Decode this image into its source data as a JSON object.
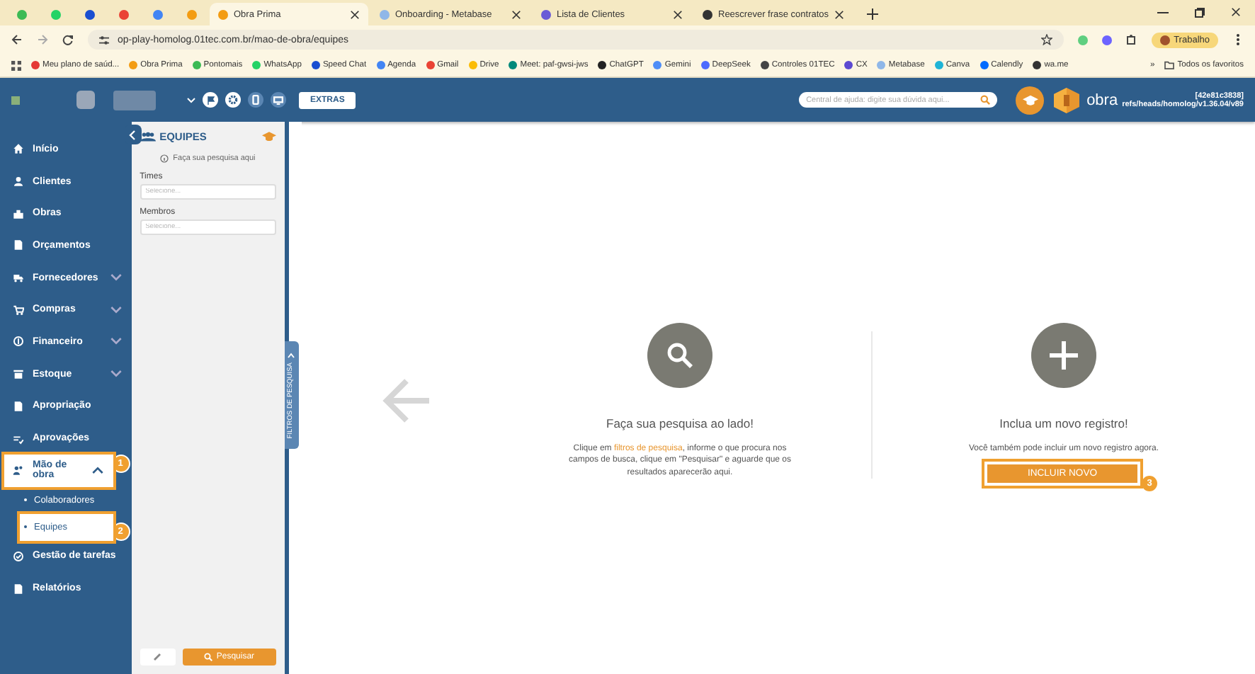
{
  "browser": {
    "pinned_tabs": [
      {
        "color": "#3cba54",
        "selected": false
      },
      {
        "color": "#25d366",
        "selected": false
      },
      {
        "color": "#1a4fd1",
        "selected": false
      },
      {
        "color": "#ea4335",
        "selected": false
      },
      {
        "color": "#4285f4",
        "selected": false
      },
      {
        "color": "#f39c12",
        "selected": false
      }
    ],
    "tabs": [
      {
        "title": "Obra Prima",
        "color": "#f39c12",
        "selected": true
      },
      {
        "title": "Onboarding - Metabase",
        "color": "#8fb7e8",
        "selected": false
      },
      {
        "title": "Lista de Clientes",
        "color": "#6b5bd6",
        "selected": false
      },
      {
        "title": "Reescrever frase contratos",
        "color": "#333333",
        "selected": false
      }
    ],
    "address": "op-play-homolog.01tec.com.br/mao-de-obra/equipes",
    "profile": "Trabalho",
    "bookmarks": [
      {
        "label": "Meu plano de saúd...",
        "color": "#e53935"
      },
      {
        "label": "Obra Prima",
        "color": "#f39c12"
      },
      {
        "label": "Pontomais",
        "color": "#3cba54"
      },
      {
        "label": "WhatsApp",
        "color": "#25d366"
      },
      {
        "label": "Speed Chat",
        "color": "#1a4fd1"
      },
      {
        "label": "Agenda",
        "color": "#4285f4"
      },
      {
        "label": "Gmail",
        "color": "#ea4335"
      },
      {
        "label": "Drive",
        "color": "#fbbc05"
      },
      {
        "label": "Meet: paf-gwsi-jws",
        "color": "#00897b"
      },
      {
        "label": "ChatGPT",
        "color": "#222222"
      },
      {
        "label": "Gemini",
        "color": "#4f8ef7"
      },
      {
        "label": "DeepSeek",
        "color": "#4d6bfe"
      },
      {
        "label": "Controles 01TEC",
        "color": "#444444"
      },
      {
        "label": "CX",
        "color": "#5c4ad1"
      },
      {
        "label": "Metabase",
        "color": "#8fb7e8"
      },
      {
        "label": "Canva",
        "color": "#1fb4d6"
      },
      {
        "label": "Calendly",
        "color": "#006bff"
      },
      {
        "label": "wa.me",
        "color": "#333333"
      }
    ],
    "more_bookmarks": "»",
    "all_bookmarks": "Todos os favoritos"
  },
  "header": {
    "extras_button": "EXTRAS",
    "search": {
      "placeholder": "Central de ajuda: digite sua dúvida aqui..."
    },
    "logo": "obra",
    "build": "[42e81c3838]",
    "branch": "refs/heads/homolog/v1.36.04/v89"
  },
  "sidebar": {
    "items": [
      {
        "label": "Início",
        "selected": false
      },
      {
        "label": "Clientes",
        "selected": false
      },
      {
        "label": "Obras",
        "selected": false
      },
      {
        "label": "Orçamentos",
        "selected": false
      },
      {
        "label": "Fornecedores",
        "selected": false,
        "expanded": false
      },
      {
        "label": "Compras",
        "selected": false,
        "expanded": false
      },
      {
        "label": "Financeiro",
        "selected": false,
        "expanded": false
      },
      {
        "label": "Estoque",
        "selected": false,
        "expanded": false
      },
      {
        "label": "Apropriação",
        "selected": false
      },
      {
        "label": "Aprovações",
        "selected": false
      },
      {
        "label": "Mão de obra",
        "selected": false,
        "expanded": true,
        "callout": "1",
        "children": [
          {
            "label": "Colaboradores",
            "selected": false
          },
          {
            "label": "Equipes",
            "selected": true,
            "callout": "2"
          }
        ]
      },
      {
        "label": "Gestão de tarefas",
        "selected": false
      },
      {
        "label": "Relatórios",
        "selected": false
      }
    ]
  },
  "filter_panel": {
    "title": "EQUIPES",
    "hint": "Faça sua pesquisa aqui",
    "fields": [
      {
        "label": "Times",
        "placeholder": "Selecione..."
      },
      {
        "label": "Membros",
        "placeholder": "Selecione..."
      }
    ],
    "search_button": "Pesquisar",
    "side_tab": "FILTROS DE PESQUISA"
  },
  "main": {
    "search_card": {
      "title": "Faça sua pesquisa ao lado!",
      "text": "Clique em **filtros de pesquisa**, informe o que procura nos campos de busca, clique em \"Pesquisar\" e aguarde que os resultados aparecerão aqui."
    },
    "new_card": {
      "title": "Inclua um novo registro!",
      "text": "Você também pode incluir um novo registro agora.",
      "button": "INCLUIR NOVO",
      "callout": "3"
    }
  }
}
